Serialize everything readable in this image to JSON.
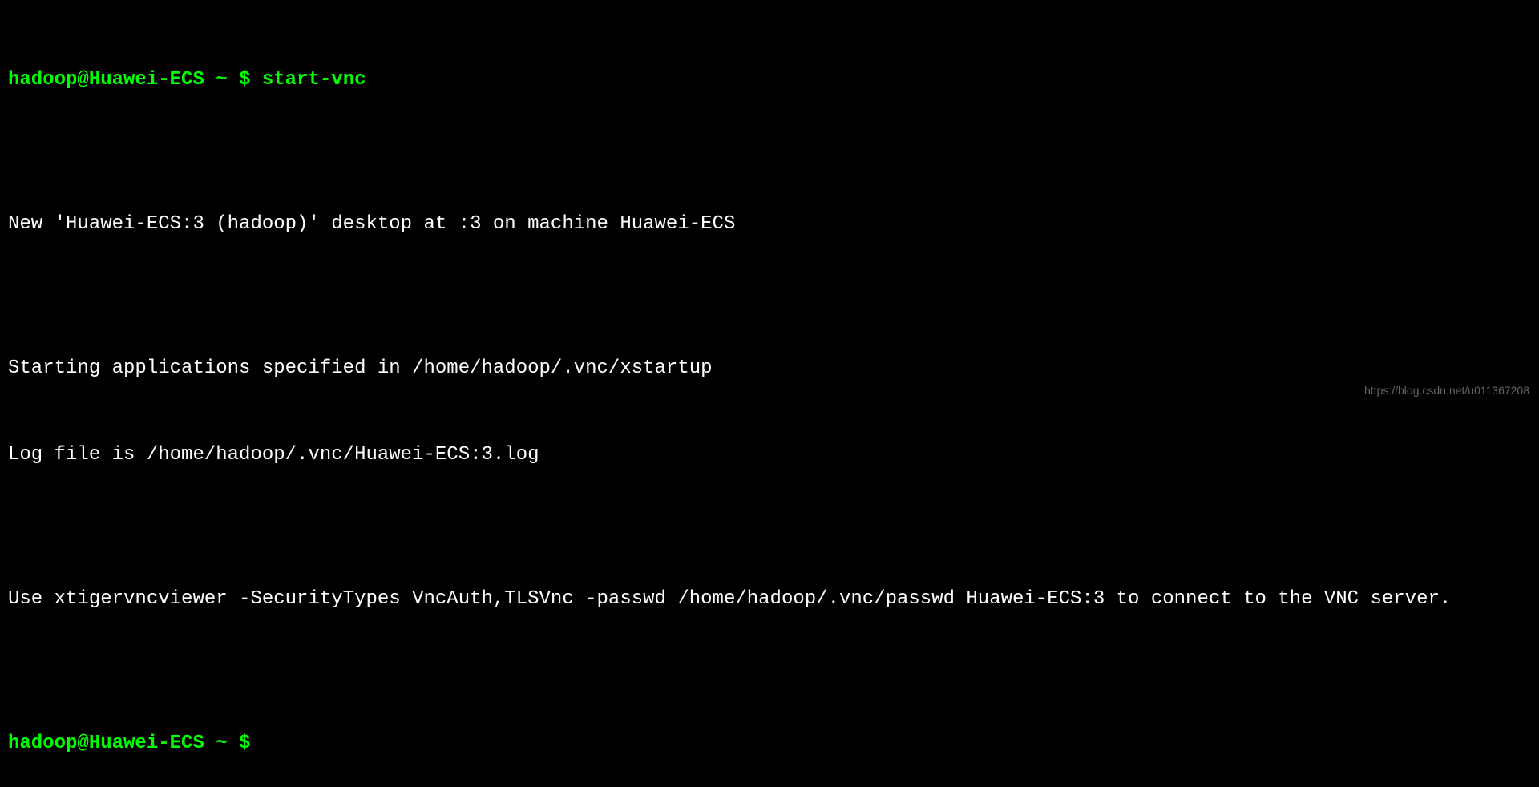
{
  "terminal": {
    "prompt1": {
      "user_host": "hadoop@Huawei-ECS",
      "path": "~",
      "symbol": "$",
      "command": "start-vnc"
    },
    "output": {
      "line1": "",
      "line2": "New 'Huawei-ECS:3 (hadoop)' desktop at :3 on machine Huawei-ECS",
      "line3": "",
      "line4": "Starting applications specified in /home/hadoop/.vnc/xstartup",
      "line5": "Log file is /home/hadoop/.vnc/Huawei-ECS:3.log",
      "line6": "",
      "line7": "Use xtigervncviewer -SecurityTypes VncAuth,TLSVnc -passwd /home/hadoop/.vnc/passwd Huawei-ECS:3 to connect to the VNC server.",
      "line8": ""
    },
    "prompt2": {
      "user_host": "hadoop@Huawei-ECS",
      "path": "~",
      "symbol": "$",
      "command": ""
    }
  },
  "watermark": "https://blog.csdn.net/u011367208"
}
